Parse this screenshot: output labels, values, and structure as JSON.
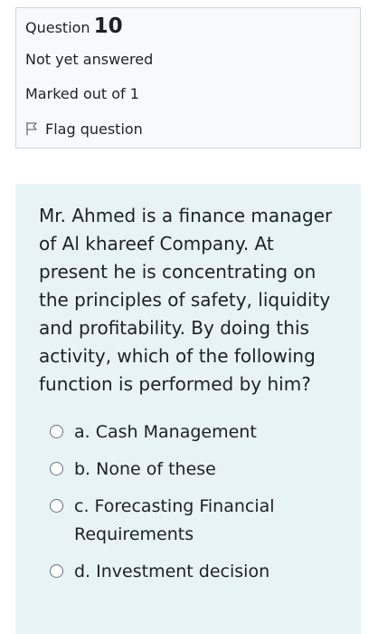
{
  "info": {
    "question_label": "Question",
    "question_number": "10",
    "status": "Not yet answered",
    "marks": "Marked out of 1",
    "flag_label": "Flag question",
    "flag_icon": "flag-icon"
  },
  "question": {
    "text": "Mr. Ahmed is a finance manager of Al khareef Company. At present he is concentrating on the principles of safety, liquidity and profitability. By doing this activity, which of the following function is performed by him?",
    "answers": [
      "a. Cash Management",
      "b. None of these",
      "c. Forecasting Financial Requirements",
      "d. Investment decision"
    ]
  },
  "colors": {
    "info_background": "#f8f9fa",
    "content_background": "#e7f3f5",
    "border": "#ced4da",
    "text": "#1d2125"
  }
}
